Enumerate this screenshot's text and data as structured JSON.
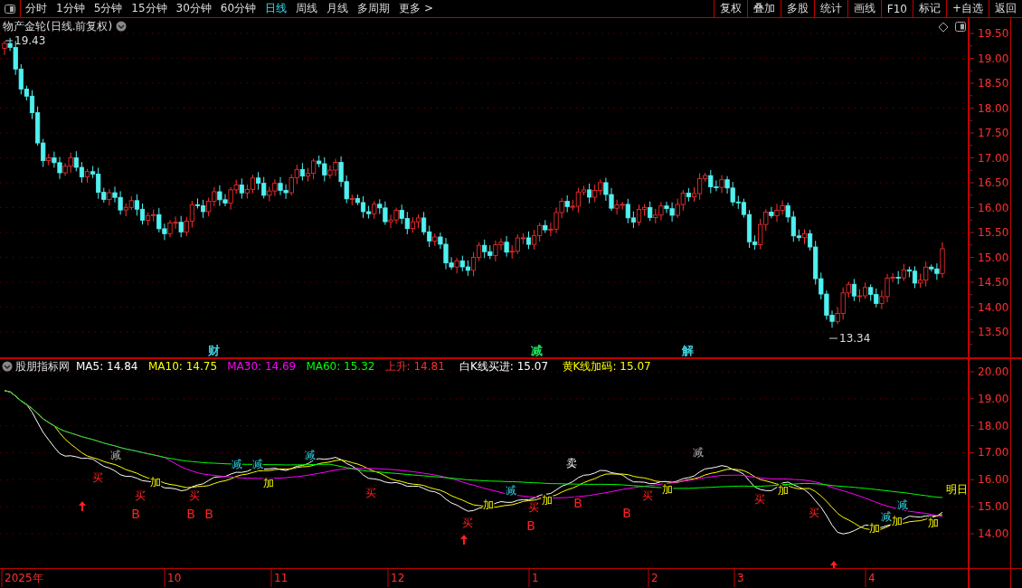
{
  "toolbar": {
    "periods": [
      {
        "label": "分时",
        "selected": false
      },
      {
        "label": "1分钟",
        "selected": false
      },
      {
        "label": "5分钟",
        "selected": false
      },
      {
        "label": "15分钟",
        "selected": false
      },
      {
        "label": "30分钟",
        "selected": false
      },
      {
        "label": "60分钟",
        "selected": false
      },
      {
        "label": "日线",
        "selected": true
      },
      {
        "label": "周线",
        "selected": false
      },
      {
        "label": "月线",
        "selected": false
      },
      {
        "label": "多周期",
        "selected": false
      },
      {
        "label": "更多 >",
        "selected": false
      }
    ],
    "buttons": [
      "复权",
      "叠加",
      "多股",
      "统计",
      "画线",
      "F10",
      "标记",
      "+自选",
      "返回"
    ]
  },
  "main_chart": {
    "title": "物产金轮(日线.前复权)",
    "high_label": "19.43",
    "low_label": "13.34",
    "y_axis": [
      "19.50",
      "19.00",
      "18.50",
      "18.00",
      "17.50",
      "17.00",
      "16.50",
      "16.00",
      "15.50",
      "15.00",
      "14.50",
      "14.00",
      "13.50"
    ],
    "markers": [
      {
        "text": "财",
        "color": "#40d0e0"
      },
      {
        "text": "减",
        "color": "#20e060"
      },
      {
        "text": "解",
        "color": "#40d0e0"
      }
    ]
  },
  "indicator": {
    "name": "股朋指标网",
    "legend": [
      {
        "text": "MA5: 14.84",
        "color": "#ffffff"
      },
      {
        "text": "MA10: 14.75",
        "color": "#ffff00"
      },
      {
        "text": "MA30: 14.69",
        "color": "#ff00ff"
      },
      {
        "text": "MA60: 15.32",
        "color": "#00ff00"
      },
      {
        "text": "上升: 14.81",
        "color": "#ff3030"
      },
      {
        "text": "白K线买进: 15.07",
        "color": "#ffffff"
      },
      {
        "text": "黄K线加码: 15.07",
        "color": "#ffff00"
      }
    ],
    "y_axis": [
      "20.00",
      "19.00",
      "18.00",
      "17.00",
      "16.00",
      "15.00",
      "14.00"
    ],
    "signals": [
      {
        "text": "减",
        "kind": "reduce_dim"
      },
      {
        "text": "买",
        "kind": "buy"
      },
      {
        "text": "加",
        "kind": "add"
      },
      {
        "text": "买",
        "kind": "buy"
      },
      {
        "text": "B",
        "kind": "b"
      },
      {
        "text": "买",
        "kind": "buy"
      },
      {
        "text": "B",
        "kind": "b"
      },
      {
        "text": "B",
        "kind": "b"
      },
      {
        "text": "减",
        "kind": "reduce"
      },
      {
        "text": "减",
        "kind": "reduce"
      },
      {
        "text": "加",
        "kind": "add"
      },
      {
        "text": "减",
        "kind": "reduce"
      },
      {
        "text": "买",
        "kind": "buy"
      },
      {
        "text": "买",
        "kind": "buy"
      },
      {
        "text": "加",
        "kind": "add"
      },
      {
        "text": "减",
        "kind": "reduce"
      },
      {
        "text": "买",
        "kind": "buy"
      },
      {
        "text": "B",
        "kind": "b"
      },
      {
        "text": "加",
        "kind": "add"
      },
      {
        "text": "卖",
        "kind": "sell"
      },
      {
        "text": "B",
        "kind": "b"
      },
      {
        "text": "B",
        "kind": "b"
      },
      {
        "text": "买",
        "kind": "buy"
      },
      {
        "text": "加",
        "kind": "add"
      },
      {
        "text": "减",
        "kind": "reduce_dim"
      },
      {
        "text": "买",
        "kind": "buy"
      },
      {
        "text": "加",
        "kind": "add"
      },
      {
        "text": "买",
        "kind": "buy"
      },
      {
        "text": "减",
        "kind": "reduce"
      },
      {
        "text": "加",
        "kind": "add"
      },
      {
        "text": "减",
        "kind": "reduce"
      },
      {
        "text": "加",
        "kind": "add"
      },
      {
        "text": "加",
        "kind": "add"
      },
      {
        "text": "明日",
        "kind": "add"
      }
    ]
  },
  "time_axis": [
    "2025年",
    "10",
    "11",
    "12",
    "1",
    "2",
    "3",
    "4"
  ]
}
